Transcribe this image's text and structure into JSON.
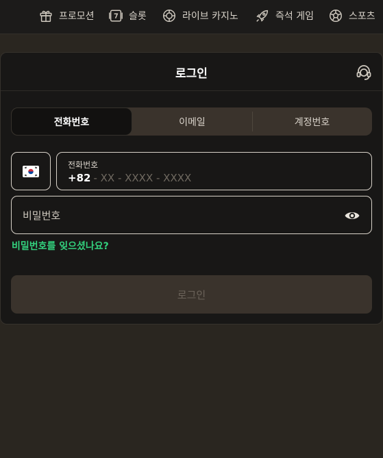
{
  "nav": {
    "items": [
      {
        "label": "프로모션",
        "icon": "gift-icon"
      },
      {
        "label": "슬롯",
        "icon": "slot-icon"
      },
      {
        "label": "라이브 카지노",
        "icon": "casino-chip-icon"
      },
      {
        "label": "즉석 게임",
        "icon": "rocket-icon"
      },
      {
        "label": "스포츠",
        "icon": "soccer-ball-icon"
      }
    ]
  },
  "modal": {
    "title": "로그인",
    "support_icon": "support-headset-icon"
  },
  "tabs": [
    {
      "label": "전화번호",
      "active": true
    },
    {
      "label": "이메일",
      "active": false
    },
    {
      "label": "계정번호",
      "active": false
    }
  ],
  "phone": {
    "country_flag": "south-korea-flag-icon",
    "label": "전화번호",
    "prefix": "+82",
    "placeholder": "- XX - XXXX - XXXX"
  },
  "password": {
    "placeholder": "비밀번호",
    "toggle_icon": "eye-icon"
  },
  "forgot_label": "비밀번호를 잊으셨나요?",
  "login_button": "로그인",
  "colors": {
    "accent_green": "#33d27e",
    "background": "#2a2620",
    "modal_bg": "#181716",
    "button_bg": "#3a332c"
  }
}
